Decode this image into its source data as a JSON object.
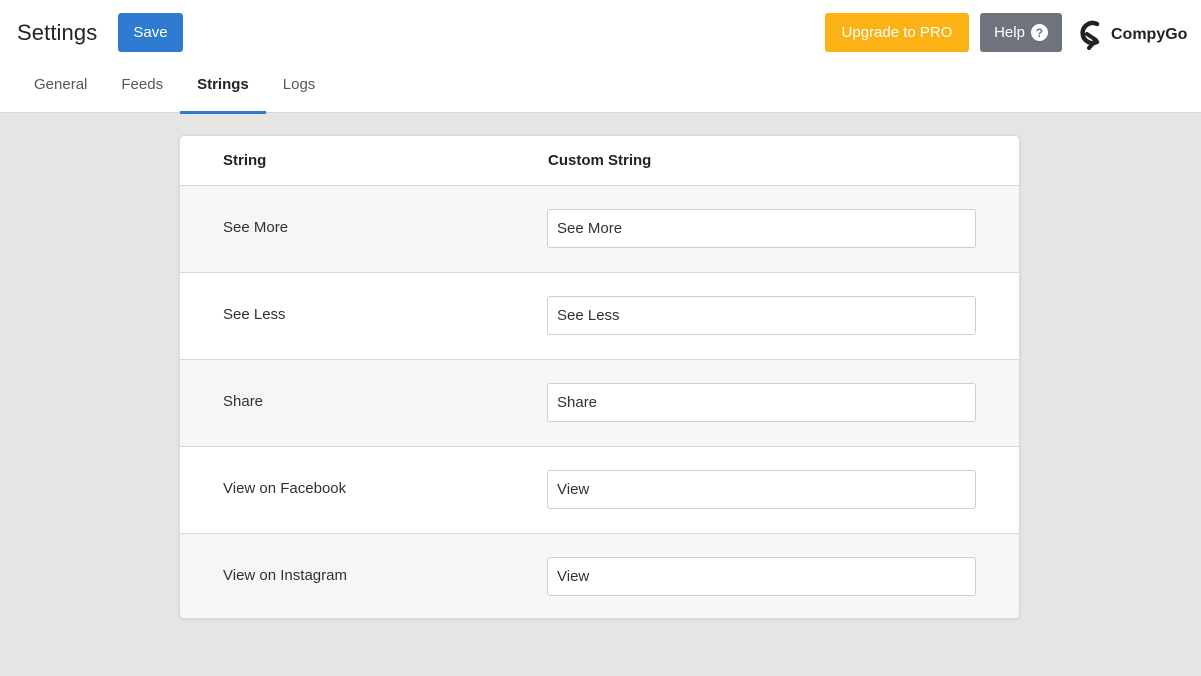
{
  "header": {
    "title": "Settings",
    "save_label": "Save",
    "upgrade_label": "Upgrade to PRO",
    "help_label": "Help",
    "help_icon": "?",
    "brand_name": "CompyGo"
  },
  "tabs": [
    {
      "label": "General",
      "active": false
    },
    {
      "label": "Feeds",
      "active": false
    },
    {
      "label": "Strings",
      "active": true
    },
    {
      "label": "Logs",
      "active": false
    }
  ],
  "table": {
    "headers": {
      "string": "String",
      "custom": "Custom String"
    },
    "rows": [
      {
        "label": "See More",
        "value": "See More"
      },
      {
        "label": "See Less",
        "value": "See Less"
      },
      {
        "label": "Share",
        "value": "Share"
      },
      {
        "label": "View on Facebook",
        "value": "View"
      },
      {
        "label": "View on Instagram",
        "value": "View"
      }
    ]
  },
  "colors": {
    "primary": "#2e7bcf",
    "upgrade": "#fcb214",
    "help": "#6d747b",
    "background": "#e5e5e3"
  }
}
